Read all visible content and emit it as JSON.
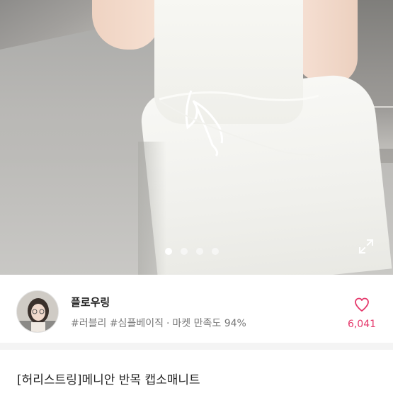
{
  "carousel": {
    "total_slides": 4,
    "active_index": 0
  },
  "seller": {
    "name": "플로우링",
    "tag_1": "#러블리",
    "tag_2": "#심플베이직",
    "separator": "·",
    "satisfaction": "마켓 만족도 94%"
  },
  "like": {
    "count": "6,041",
    "icon": "heart-outline-icon",
    "color": "#e5386b"
  },
  "product": {
    "title": "[허리스트링]메니안 반목 캡소매니트"
  },
  "icons": {
    "expand": "expand-icon"
  }
}
